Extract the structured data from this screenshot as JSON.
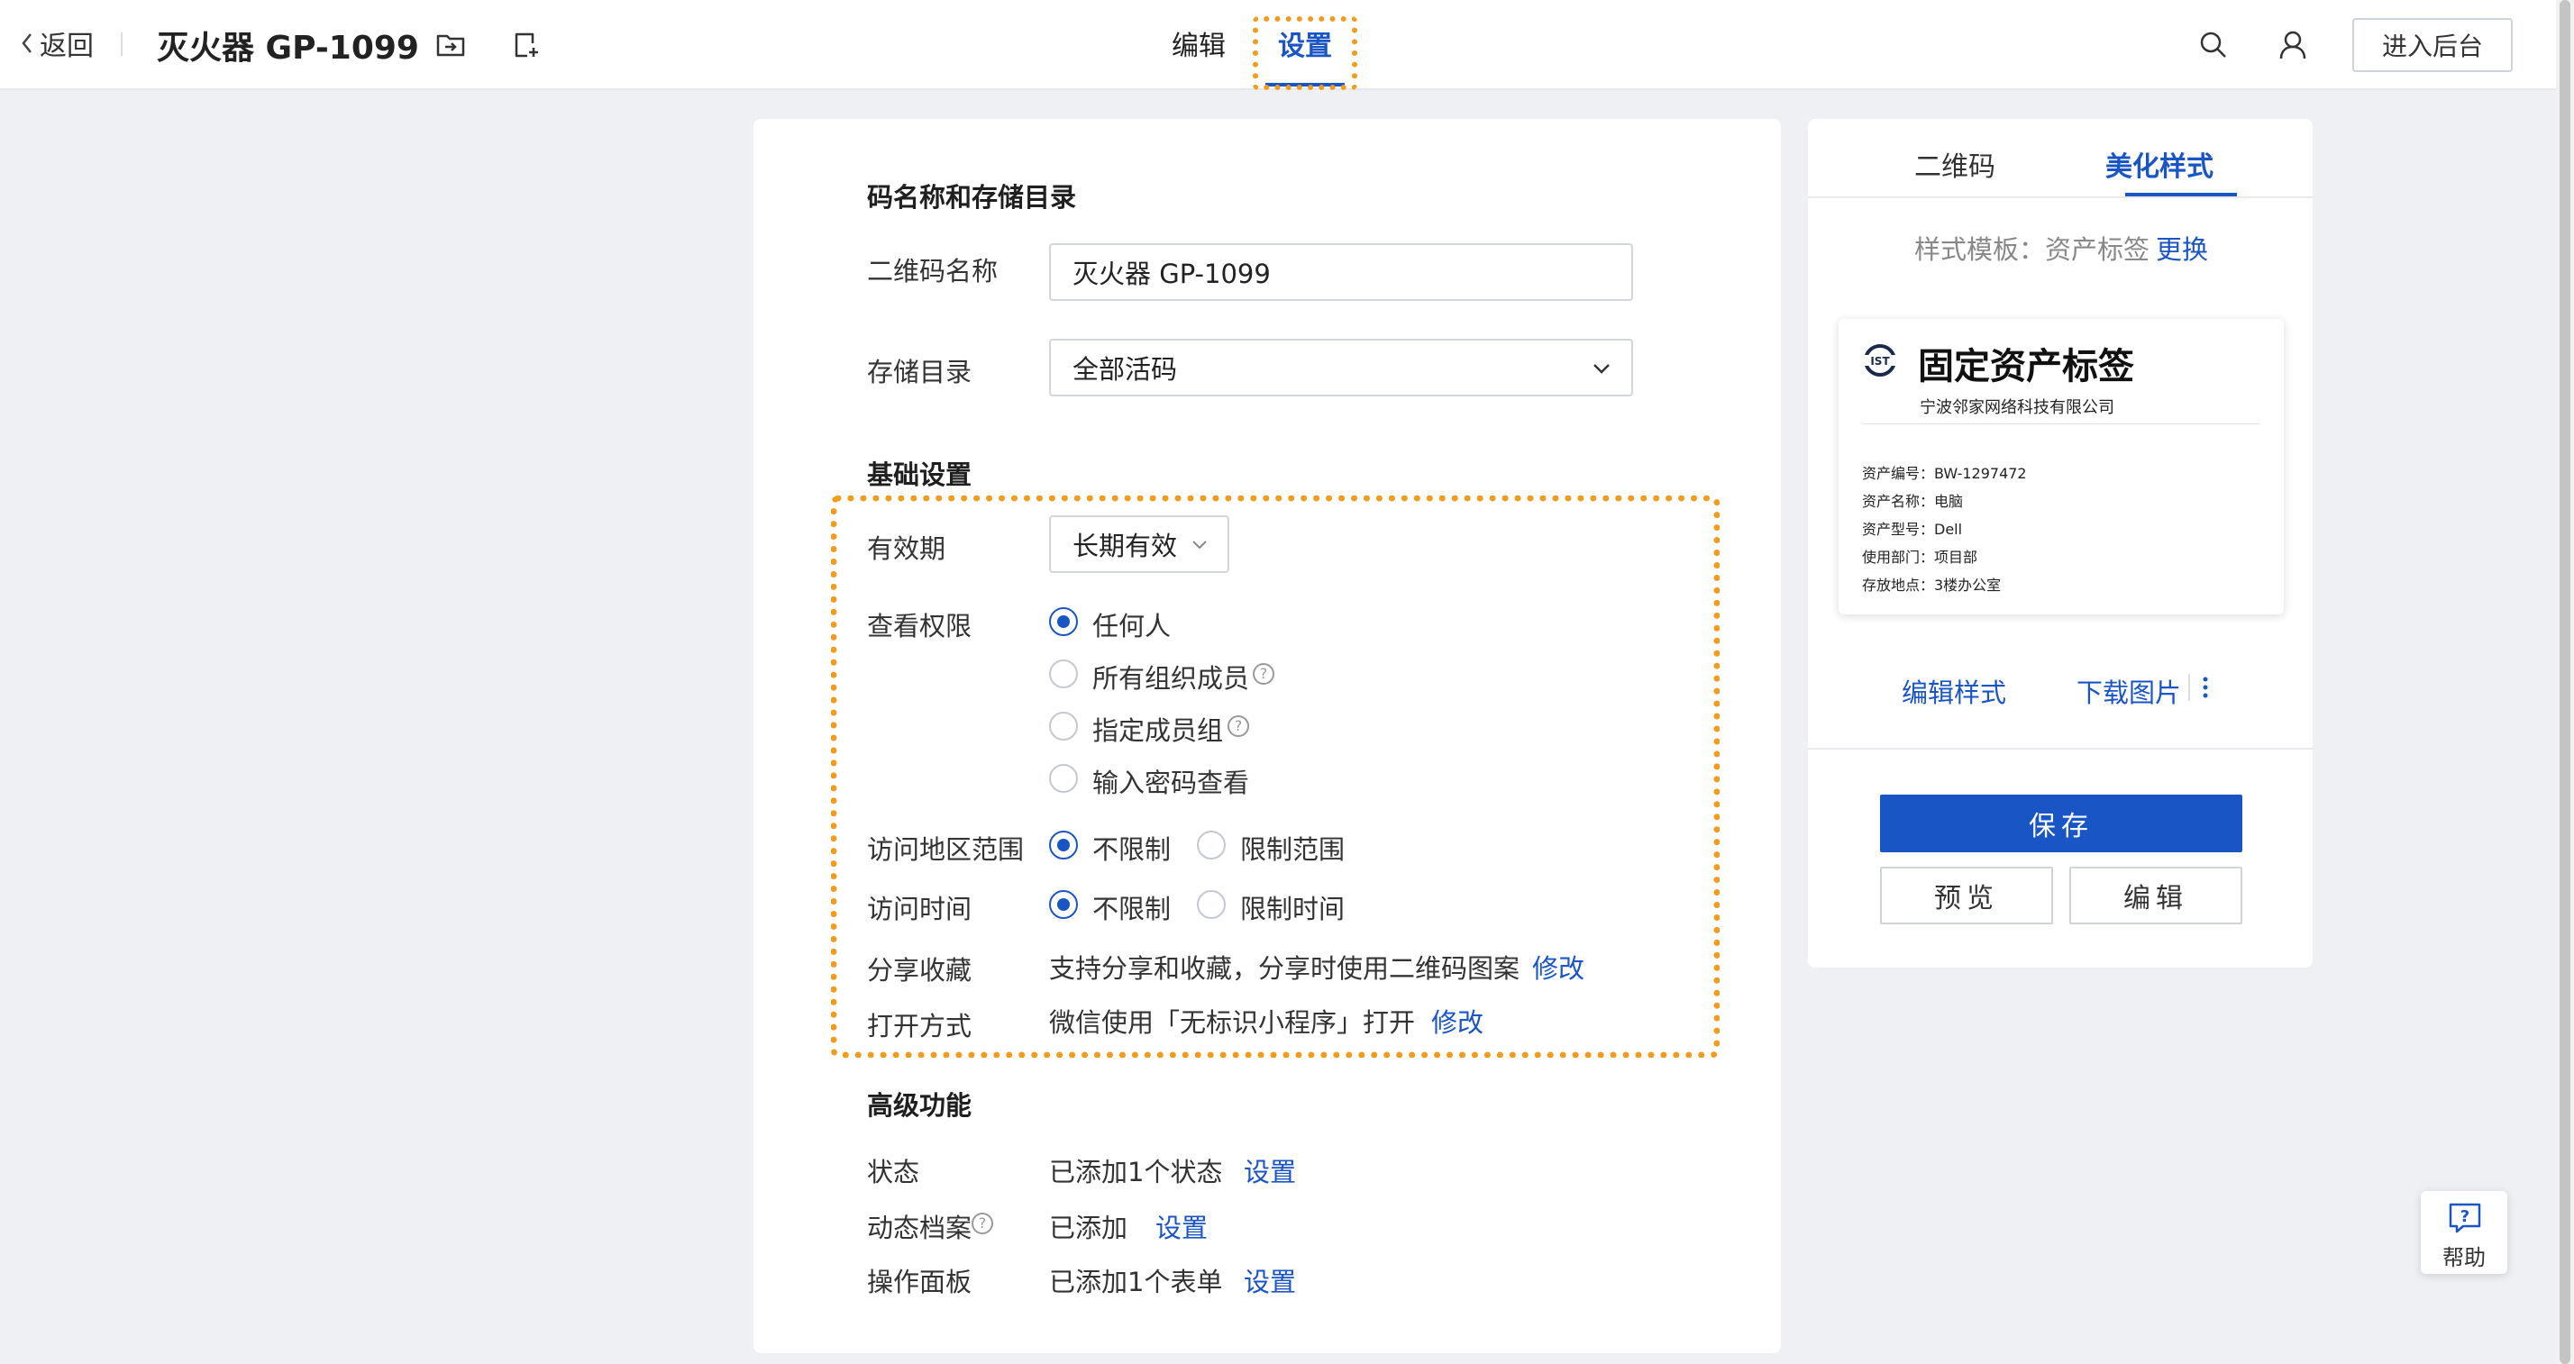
{
  "topbar": {
    "back_label": "返回",
    "doc_title": "灭火器 GP-1099",
    "tabs": [
      "编辑",
      "设置"
    ],
    "active_tab": "设置",
    "backend_button": "进入后台"
  },
  "main": {
    "section_name": {
      "title": "码名称和存储目录",
      "name_label": "二维码名称",
      "name_value": "灭火器 GP-1099",
      "dir_label": "存储目录",
      "dir_value": "全部活码"
    },
    "section_basic": {
      "title": "基础设置",
      "validity_label": "有效期",
      "validity_value": "长期有效",
      "view_label": "查看权限",
      "view_options": [
        "任何人",
        "所有组织成员",
        "指定成员组",
        "输入密码查看"
      ],
      "view_selected": "任何人",
      "region_label": "访问地区范围",
      "region_options": [
        "不限制",
        "限制范围"
      ],
      "region_selected": "不限制",
      "time_label": "访问时间",
      "time_options": [
        "不限制",
        "限制时间"
      ],
      "time_selected": "不限制",
      "share_label": "分享收藏",
      "share_value": "支持分享和收藏，分享时使用二维码图案",
      "share_link": "修改",
      "open_label": "打开方式",
      "open_value": "微信使用「无标识小程序」打开",
      "open_link": "修改"
    },
    "section_advanced": {
      "title": "高级功能",
      "rows": [
        {
          "label": "状态",
          "value": "已添加1个状态",
          "link": "设置"
        },
        {
          "label": "动态档案",
          "value": "已添加",
          "link": "设置"
        },
        {
          "label": "操作面板",
          "value": "已添加1个表单",
          "link": "设置"
        }
      ]
    }
  },
  "side": {
    "tabs": [
      "二维码",
      "美化样式"
    ],
    "active_tab": "美化样式",
    "template_label": "样式模板：资产标签",
    "template_change": "更换",
    "card": {
      "title": "固定资产标签",
      "company": "宁波邻家网络科技有限公司",
      "rows": [
        "资产编号：BW-1297472",
        "资产名称：电脑",
        "资产型号：Dell",
        "使用部门：项目部",
        "存放地点：3楼办公室"
      ]
    },
    "edit_style": "编辑样式",
    "download": "下载图片",
    "save": "保存",
    "preview": "预览",
    "edit": "编辑"
  },
  "help": {
    "label": "帮助"
  },
  "colors": {
    "accent": "#1a55c6",
    "highlight": "#f29b1d",
    "background": "#eef0f4"
  }
}
